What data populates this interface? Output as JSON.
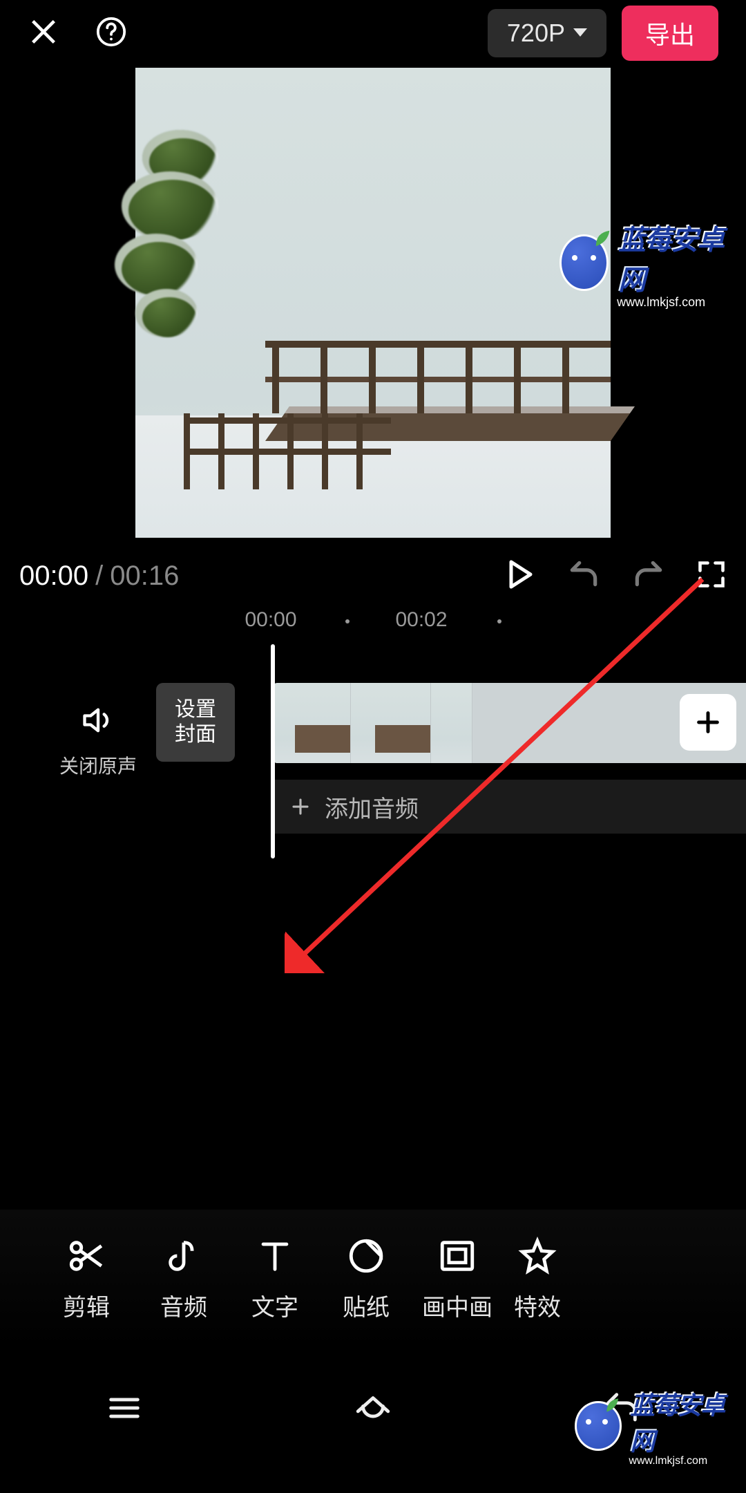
{
  "top": {
    "resolution": "720P",
    "export_label": "导出"
  },
  "playbar": {
    "current": "00:00",
    "separator": "/",
    "total": "00:16"
  },
  "ruler": {
    "t0": "00:00",
    "t1": "00:02"
  },
  "timeline": {
    "mute_label": "关闭原声",
    "cover_line1": "设置",
    "cover_line2": "封面",
    "add_audio": "添加音频"
  },
  "tools": {
    "edit": "剪辑",
    "audio": "音频",
    "text": "文字",
    "sticker": "贴纸",
    "pip": "画中画",
    "effects": "特效"
  },
  "watermark": {
    "title": "蓝莓安卓网",
    "url": "www.lmkjsf.com"
  }
}
